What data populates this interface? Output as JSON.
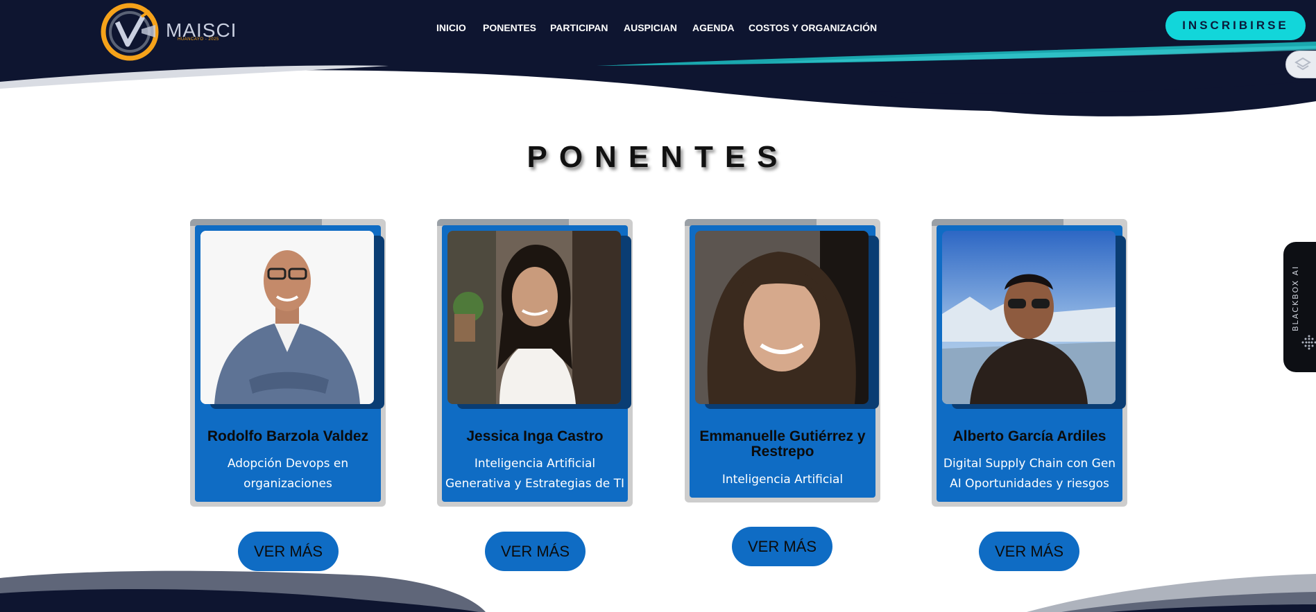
{
  "header": {
    "logo_text": "MAISCI",
    "logo_subtext": "HUANCAYO - 2025",
    "nav": [
      {
        "label": "INICIO"
      },
      {
        "label": "PONENTES"
      },
      {
        "label": "PARTICIPAN"
      },
      {
        "label": "AUSPICIAN"
      },
      {
        "label": "AGENDA"
      },
      {
        "label": "COSTOS Y ORGANIZACIÓN"
      }
    ],
    "cta_label": "INSCRIBIRSE"
  },
  "section": {
    "title": "PONENTES"
  },
  "speakers": [
    {
      "name": "Rodolfo Barzola Valdez",
      "topic": "Adopción Devops en organizaciones",
      "button": "VER MÁS"
    },
    {
      "name": "Jessica Inga Castro",
      "topic": "Inteligencia Artificial Generativa y Estrategias de TI",
      "button": "VER MÁS"
    },
    {
      "name": "Emmanuelle Gutiérrez y Restrepo",
      "topic": "Inteligencia Artificial",
      "button": "VER MÁS"
    },
    {
      "name": "Alberto García Ardiles",
      "topic": "Digital Supply Chain con Gen AI Oportunidades y riesgos",
      "button": "VER MÁS"
    }
  ],
  "sidebar_widget": {
    "label": "BLACKBOX AI"
  },
  "colors": {
    "header_navy": "#0e1530",
    "accent_cyan": "#12d6da",
    "card_blue": "#0f6cc4",
    "logo_orange": "#f5a21a"
  }
}
